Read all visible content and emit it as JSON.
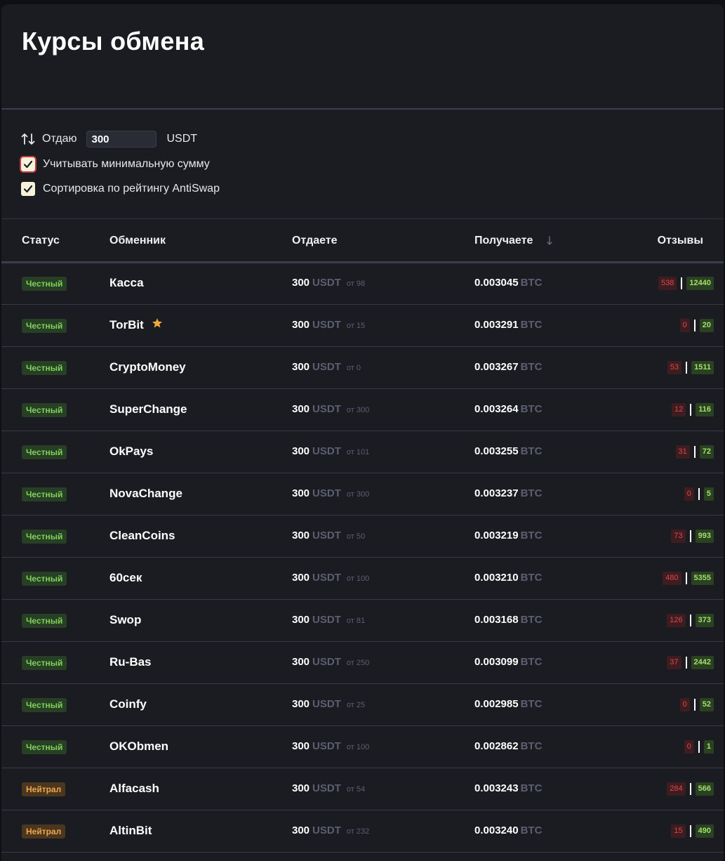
{
  "page": {
    "title": "Курсы обмена"
  },
  "controls": {
    "give_label": "Отдаю",
    "amount": "300",
    "currency": "USDT",
    "min_sum": {
      "label": "Учитывать минимальную сумму",
      "checked": true
    },
    "sort_rating": {
      "label": "Сортировка по рейтингу AntiSwap",
      "checked": true
    }
  },
  "table": {
    "headers": {
      "status": "Статус",
      "exchanger": "Обменник",
      "give": "Отдаете",
      "get": "Получаете",
      "reviews": "Отзывы"
    },
    "give_currency": "USDT",
    "get_currency": "BTC",
    "rows": [
      {
        "status": "Честный",
        "type": "honest",
        "name": "Касса",
        "give": "300",
        "min": "от 98",
        "get": "0.003045",
        "neg": "538",
        "pos": "12440"
      },
      {
        "status": "Честный",
        "type": "honest",
        "name": "TorBit",
        "star": true,
        "give": "300",
        "min": "от 15",
        "get": "0.003291",
        "neg": "0",
        "pos": "20"
      },
      {
        "status": "Честный",
        "type": "honest",
        "name": "CryptoMoney",
        "give": "300",
        "min": "от 0",
        "get": "0.003267",
        "neg": "53",
        "pos": "1511"
      },
      {
        "status": "Честный",
        "type": "honest",
        "name": "SuperChange",
        "give": "300",
        "min": "от 300",
        "get": "0.003264",
        "neg": "12",
        "pos": "116"
      },
      {
        "status": "Честный",
        "type": "honest",
        "name": "OkPays",
        "give": "300",
        "min": "от 101",
        "get": "0.003255",
        "neg": "31",
        "pos": "72"
      },
      {
        "status": "Честный",
        "type": "honest",
        "name": "NovaChange",
        "give": "300",
        "min": "от 300",
        "get": "0.003237",
        "neg": "0",
        "pos": "5"
      },
      {
        "status": "Честный",
        "type": "honest",
        "name": "CleanCoins",
        "give": "300",
        "min": "от 50",
        "get": "0.003219",
        "neg": "73",
        "pos": "993"
      },
      {
        "status": "Честный",
        "type": "honest",
        "name": "60сек",
        "give": "300",
        "min": "от 100",
        "get": "0.003210",
        "neg": "480",
        "pos": "5355"
      },
      {
        "status": "Честный",
        "type": "honest",
        "name": "Swop",
        "give": "300",
        "min": "от 81",
        "get": "0.003168",
        "neg": "126",
        "pos": "373"
      },
      {
        "status": "Честный",
        "type": "honest",
        "name": "Ru-Bas",
        "give": "300",
        "min": "от 250",
        "get": "0.003099",
        "neg": "37",
        "pos": "2442"
      },
      {
        "status": "Честный",
        "type": "honest",
        "name": "Coinfy",
        "give": "300",
        "min": "от 25",
        "get": "0.002985",
        "neg": "0",
        "pos": "52"
      },
      {
        "status": "Честный",
        "type": "honest",
        "name": "OKObmen",
        "give": "300",
        "min": "от 100",
        "get": "0.002862",
        "neg": "0",
        "pos": "1"
      },
      {
        "status": "Нейтрал",
        "type": "neutral",
        "name": "Alfacash",
        "give": "300",
        "min": "от 54",
        "get": "0.003243",
        "neg": "284",
        "pos": "566"
      },
      {
        "status": "Нейтрал",
        "type": "neutral",
        "name": "AltinBit",
        "give": "300",
        "min": "от 232",
        "get": "0.003240",
        "neg": "15",
        "pos": "490"
      }
    ]
  }
}
